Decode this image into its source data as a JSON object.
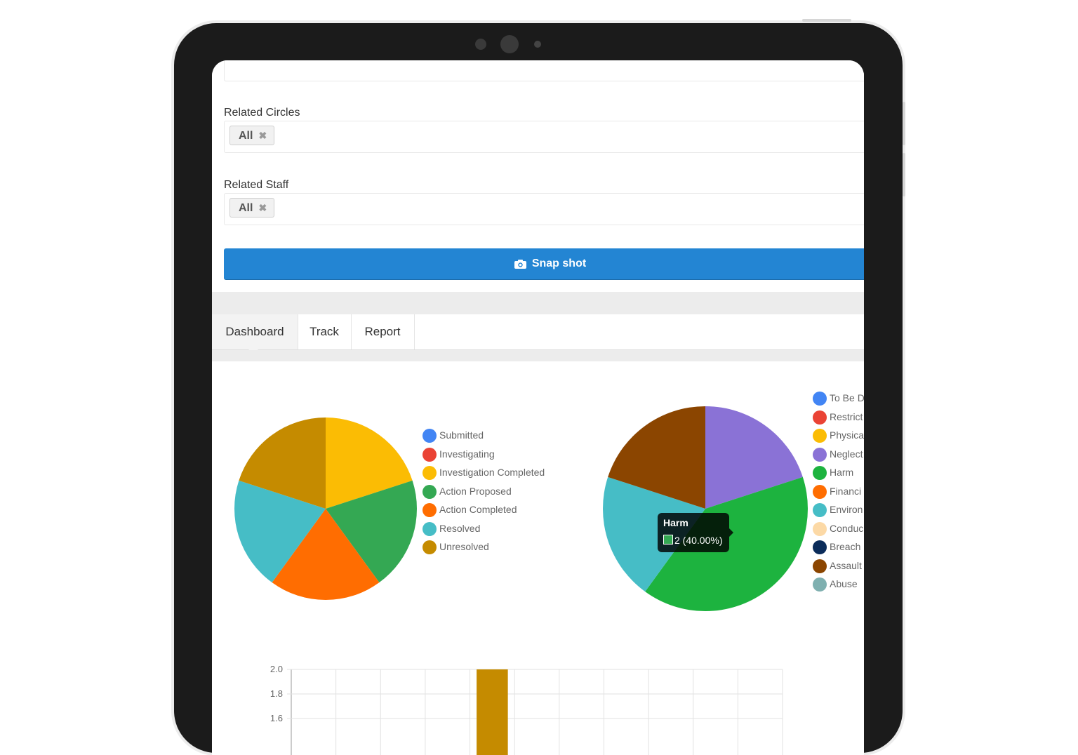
{
  "filters": {
    "related_circles": {
      "label": "Related Circles",
      "chip": "All",
      "chip_remove": "✖"
    },
    "related_staff": {
      "label": "Related Staff",
      "chip": "All",
      "chip_remove": "✖"
    }
  },
  "snapshot_button": {
    "label": "Snap shot",
    "icon": "camera-icon"
  },
  "tabs": [
    {
      "label": "Dashboard",
      "active": true
    },
    {
      "label": "Track",
      "active": false
    },
    {
      "label": "Report",
      "active": false
    }
  ],
  "tooltip": {
    "title": "Harm",
    "body": "2 (40.00%)"
  },
  "colors": {
    "accent": "#2385d3"
  },
  "chart_data": [
    {
      "type": "pie",
      "legend_position": "right",
      "series": [
        {
          "name": "Submitted",
          "value": 0,
          "color": "#4285f4"
        },
        {
          "name": "Investigating",
          "value": 0,
          "color": "#ea4335"
        },
        {
          "name": "Investigation Completed",
          "value": 1,
          "color": "#fbbc04"
        },
        {
          "name": "Action Proposed",
          "value": 1,
          "color": "#34a853"
        },
        {
          "name": "Action Completed",
          "value": 1,
          "color": "#ff6d01"
        },
        {
          "name": "Resolved",
          "value": 1,
          "color": "#46bdc6"
        },
        {
          "name": "Unresolved",
          "value": 1,
          "color": "#c58b00"
        }
      ]
    },
    {
      "type": "pie",
      "legend_position": "right",
      "series": [
        {
          "name": "To Be D",
          "value": 0,
          "color": "#4285f4"
        },
        {
          "name": "Restrict",
          "value": 0,
          "color": "#ea4335"
        },
        {
          "name": "Physica",
          "value": 0,
          "color": "#fbbc04"
        },
        {
          "name": "Neglect",
          "value": 1,
          "color": "#8a72d6"
        },
        {
          "name": "Harm",
          "value": 2,
          "color": "#1db33f"
        },
        {
          "name": "Financi",
          "value": 0,
          "color": "#ff6d01"
        },
        {
          "name": "Environ",
          "value": 1,
          "color": "#46bdc6"
        },
        {
          "name": "Conduc",
          "value": 0,
          "color": "#fcd9a6"
        },
        {
          "name": "Breach",
          "value": 0,
          "color": "#0b2c5a"
        },
        {
          "name": "Assault",
          "value": 1,
          "color": "#8b4500"
        },
        {
          "name": "Abuse",
          "value": 0,
          "color": "#7fb0b0"
        }
      ]
    },
    {
      "type": "bar",
      "ylim": [
        1.6,
        2.0
      ],
      "yticks": [
        "2.0",
        "1.8",
        "1.6"
      ],
      "bar_index": 4,
      "bar_value": 2.0,
      "bar_color": "#c58b00",
      "grid": true
    }
  ]
}
